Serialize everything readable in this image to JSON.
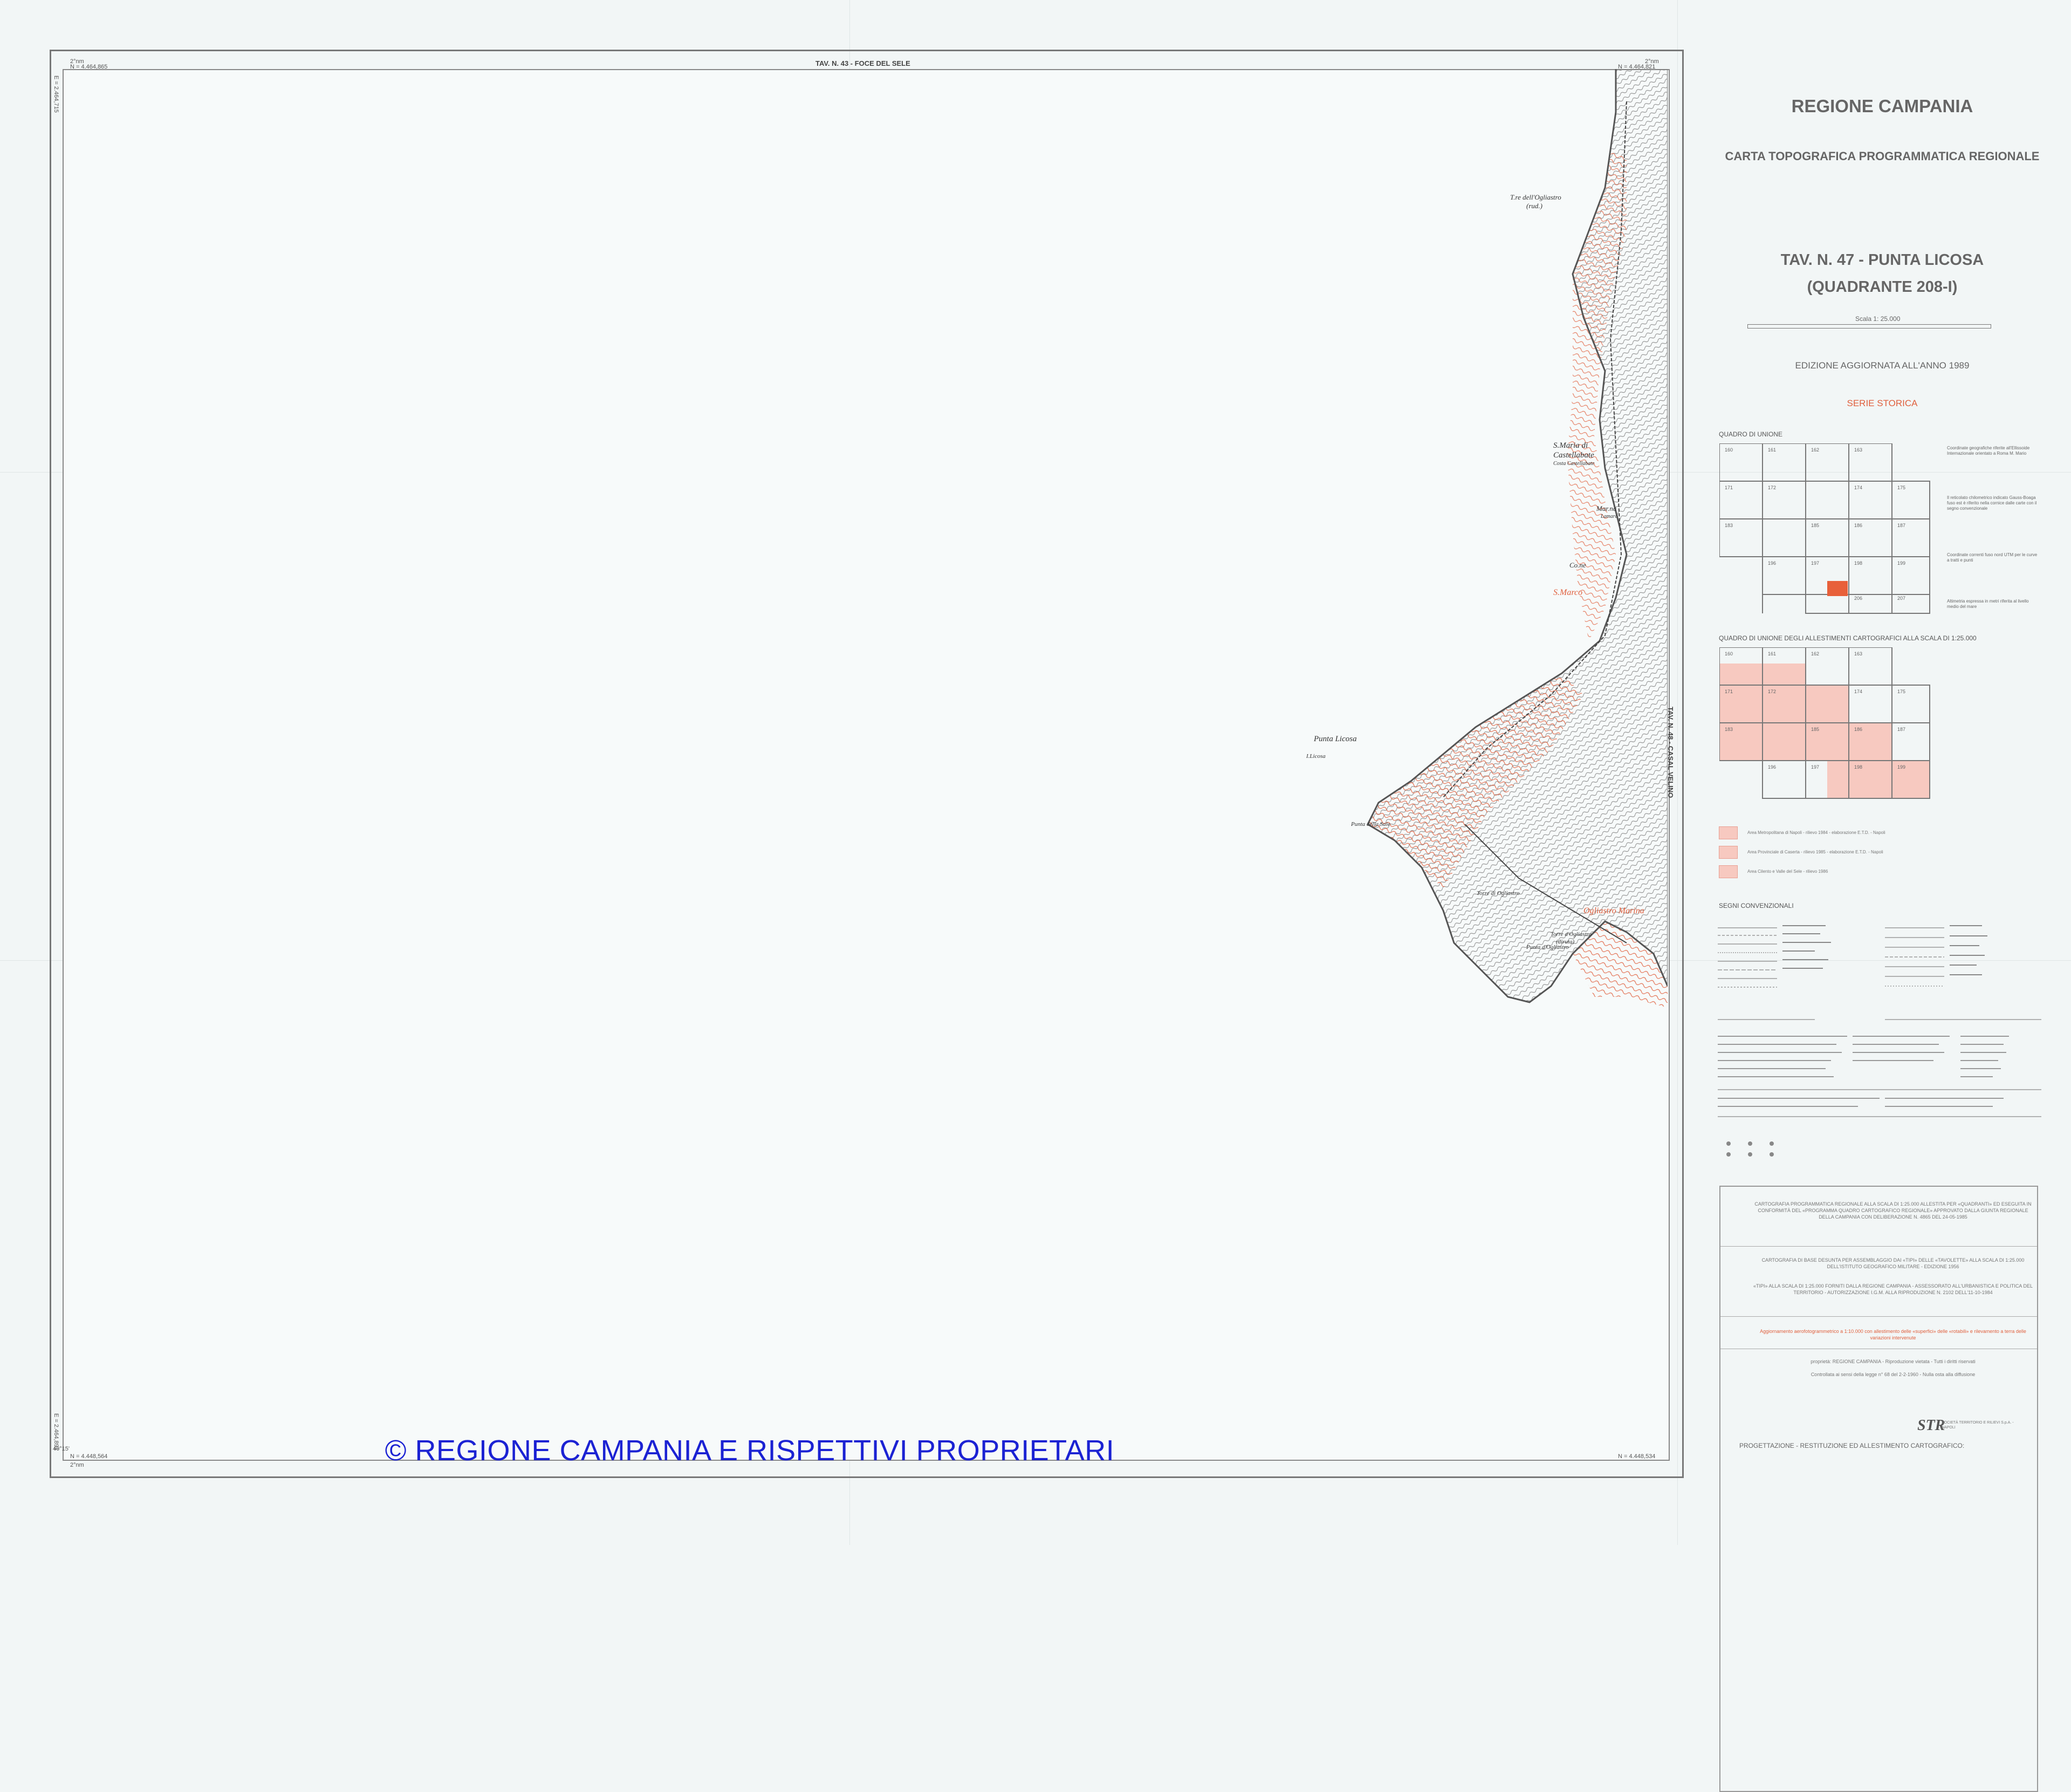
{
  "map": {
    "top_label": "TAV. N. 43 - FOCE DEL SELE",
    "right_label": "TAV. N. 48 - CASAL VELINO",
    "corner_coords": {
      "tl_lon": "2°nm",
      "tl_n": "N = 4.464,865",
      "tl_e": "E = 2.464,715",
      "tr_lon": "2°nm",
      "tr_n": "N = 4.464,821",
      "bl_lat": "40°15'",
      "bl_n": "N = 4.448,564",
      "bl_e": "E = 2.464,891",
      "br_n": "N = 4.448,534",
      "bottom_label": "2°nm"
    },
    "places": {
      "torre_ogliastro": "T.re dell'Ogliastro",
      "torre_ogliastro_sub": "(rud.)",
      "santa_maria": "S.Maria di",
      "castellabate": "Castellabate",
      "santa_maria_sub": "Costa Castellabate",
      "mar_castellabate": "Mar.na",
      "mar_sub": "Lamara",
      "tempio": "Co.ne",
      "s_marco": "S.Marco",
      "punta_licosa": "Punta Licosa",
      "isola_licosa": "I.Licosa",
      "punta_sale": "Punta della Sale",
      "torre_ogliastro_2": "Torre di Ogliastro",
      "ogliastro_marina": "Ogliastro Marina",
      "punta_ogliastro": "Punta d'Ogliastro",
      "torre_ogliastro_3": "Torre d'Ogliastro",
      "torre_ogliastro_3_sub": "(diruta)"
    }
  },
  "legend": {
    "region": "REGIONE CAMPANIA",
    "subtitle": "CARTA TOPOGRAFICA PROGRAMMATICA REGIONALE",
    "sheet_title": "TAV. N. 47 - PUNTA LICOSA",
    "sheet_sub": "(QUADRANTE 208-I)",
    "scale": "Scala 1: 25.000",
    "edition": "EDIZIONE AGGIORNATA ALL'ANNO 1989",
    "series": "SERIE STORICA",
    "quadro_label": "QUADRO DI UNIONE",
    "quadro2_label": "QUADRO DI UNIONE DEGLI ALLESTIMENTI CARTOGRAFICI ALLA SCALA DI 1:25.000",
    "signs_label": "SEGNI CONVENZIONALI",
    "grid1_numbers": [
      "160",
      "161",
      "162",
      "163",
      "171",
      "172",
      "174",
      "175",
      "183",
      "185",
      "186",
      "187",
      "196",
      "197",
      "198",
      "199",
      "205",
      "206",
      "207"
    ],
    "grid2_numbers": [
      "160",
      "161",
      "162",
      "163",
      "171",
      "172",
      "174",
      "175",
      "183",
      "185",
      "186",
      "187",
      "196",
      "197",
      "198",
      "199"
    ],
    "notes": [
      "Coordinate geografiche riferite all'Ellissoide Internazionale orientato a Roma M. Mario",
      "Il reticolato chilometrico indicato Gauss-Boaga fuso est è riferito nella cornice dalle carte con il segno convenzionale",
      "Coordinate correnti fuso nord UTM per le curve a tratti e punti",
      "Altimetria espressa in metri riferita al livello medio del mare"
    ],
    "swatch_labels": [
      "Area Metropolitana di Napoli - rilievo 1984 - elaborazione E.T.D. - Napoli",
      "Area Provinciale di Caserta - rilievo 1985 - elaborazione E.T.D. - Napoli",
      "Area Cilento e Valle del Sele - rilievo 1986"
    ],
    "credits": [
      "CARTOGRAFIA PROGRAMMATICA REGIONALE ALLA SCALA DI 1:25.000 ALLESTITA PER «QUADRANTI» ED ESEGUITA IN CONFORMITÀ DEL «PROGRAMMA QUADRO CARTOGRAFICO REGIONALE» APPROVATO DALLA GIUNTA REGIONALE DELLA CAMPANIA CON DELIBERAZIONE N. 4865 DEL 24-05-1985",
      "CARTOGRAFIA DI BASE DESUNTA PER ASSEMBLAGGIO DAI «TIPI» DELLE «TAVOLETTE» ALLA SCALA DI 1:25.000 DELL'ISTITUTO GEOGRAFICO MILITARE - EDIZIONE 1956",
      "«TIPI» ALLA SCALA DI 1:25.000 FORNITI DALLA REGIONE CAMPANIA - ASSESSORATO ALL'URBANISTICA E POLITICA DEL TERRITORIO - AUTORIZZAZIONE I.G.M. ALLA RIPRODUZIONE N. 2102 DELL'11-10-1984",
      "Aggiornamento aerofotogrammetrico a 1:10.000 con allestimento delle «superfici» delle «rotabili» e rilevamento a terra delle variazioni intervenute",
      "proprietà: REGIONE CAMPANIA - Riproduzione vietata - Tutti i diritti riservati",
      "Controllata ai sensi della legge n° 68 del 2-2-1960 - Nulla osta alla diffusione"
    ],
    "footer": "PROGETTAZIONE - RESTITUZIONE ED ALLESTIMENTO CARTOGRAFICO:",
    "logo": "STR",
    "logo_text": "SOCIETÀ TERRITORIO E RILIEVI S.p.A. - NAPOLI"
  },
  "watermark": "© REGIONE CAMPANIA E RISPETTIVI PROPRIETARI",
  "colors": {
    "paper": "#f2f6f6",
    "terrain_red": "#e0603e",
    "watermark_blue": "#1b22d3",
    "swatch_pink": "#f7c9c0",
    "highlight_orange": "#e8603a"
  }
}
